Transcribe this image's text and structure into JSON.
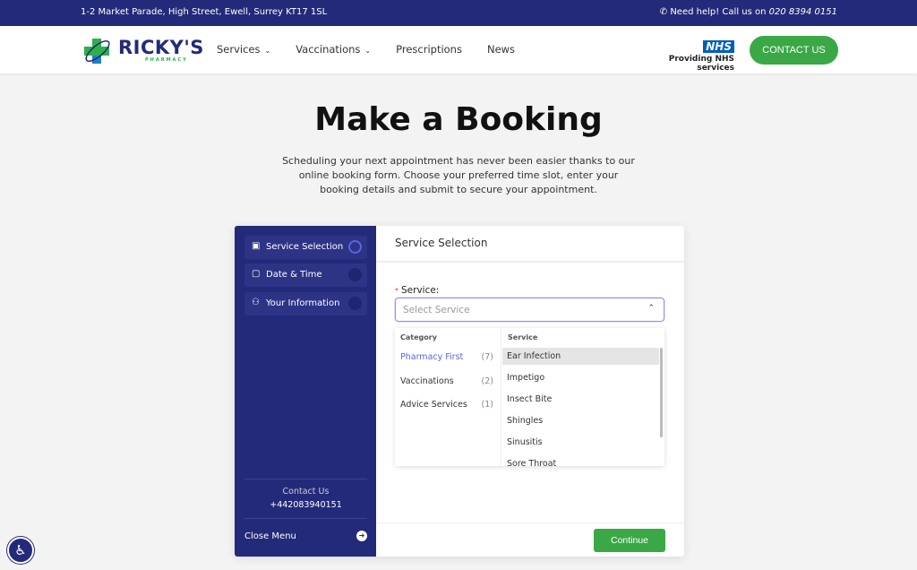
{
  "topbar": {
    "address": "1-2 Market Parade, High Street, Ewell, Surrey KT17 1SL",
    "help": "Need help! Call us on",
    "phone": "020 8394 0151"
  },
  "logo": {
    "name": "RICKY'S",
    "sub": "PHARMACY"
  },
  "nav": [
    {
      "label": "Services",
      "dropdown": true
    },
    {
      "label": "Vaccinations",
      "dropdown": true
    },
    {
      "label": "Prescriptions"
    },
    {
      "label": "News"
    }
  ],
  "nhs": {
    "badge": "NHS",
    "text": "Providing NHS services"
  },
  "contact_button": "CONTACT US",
  "page": {
    "title": "Make a Booking",
    "intro": "Scheduling your next appointment has never been easier thanks to our online booking form. Choose your preferred time slot, enter your booking details and submit to secure your appointment."
  },
  "sidebar": {
    "steps": [
      {
        "label": "Service Selection",
        "active": true
      },
      {
        "label": "Date & Time"
      },
      {
        "label": "Your Information"
      }
    ],
    "contact_label": "Contact Us",
    "contact_phone": "+442083940151",
    "close_menu": "Close Menu"
  },
  "main": {
    "title": "Service Selection",
    "field_label": "Service:",
    "placeholder": "Select Service",
    "dropdown": {
      "category_header": "Category",
      "service_header": "Service",
      "categories": [
        {
          "label": "Pharmacy First",
          "count": "(7)"
        },
        {
          "label": "Vaccinations",
          "count": "(2)"
        },
        {
          "label": "Advice Services",
          "count": "(1)"
        }
      ],
      "services": [
        "Ear Infection",
        "Impetigo",
        "Insect Bite",
        "Shingles",
        "Sinusitis",
        "Sore Throat"
      ]
    },
    "continue": "Continue"
  },
  "colors": {
    "navy": "#232a7a",
    "green": "#3aa845",
    "accent": "#5b63e0"
  }
}
